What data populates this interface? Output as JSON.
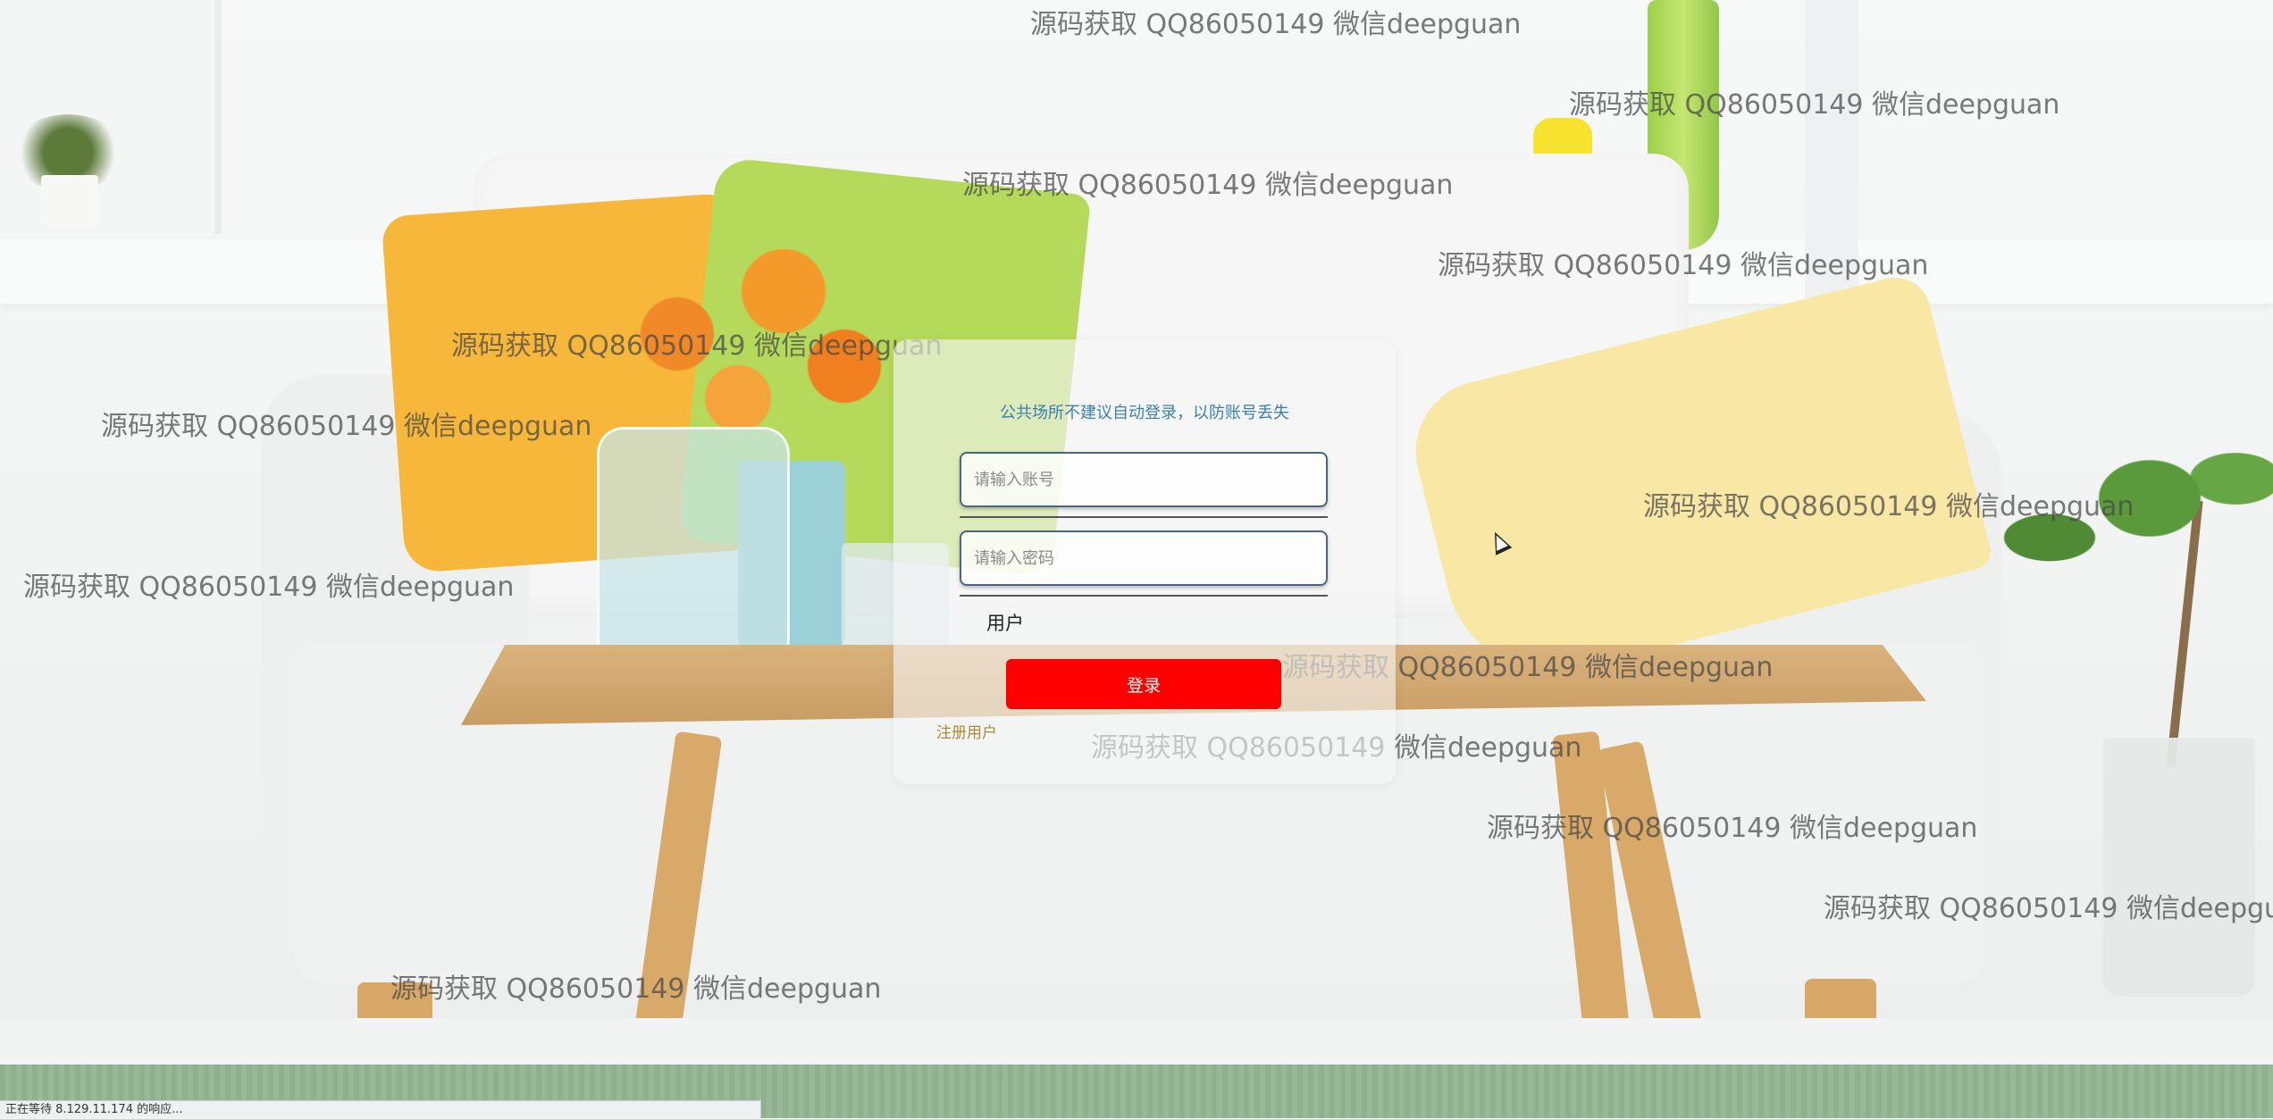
{
  "watermark": "源码获取 QQ86050149 微信deepguan",
  "login": {
    "tip": "公共场所不建议自动登录，以防账号丢失",
    "username_placeholder": "请输入账号",
    "password_placeholder": "请输入密码",
    "role_label": "用户",
    "login_button": "登录",
    "register_link": "注册用户"
  },
  "status_bar": {
    "text": "正在等待 8.129.11.174 的响应..."
  },
  "colors": {
    "login_button": "#ff0000",
    "tip_text": "#3a7fb0",
    "register_link": "#a88a3a",
    "input_border": "#4b6683"
  }
}
